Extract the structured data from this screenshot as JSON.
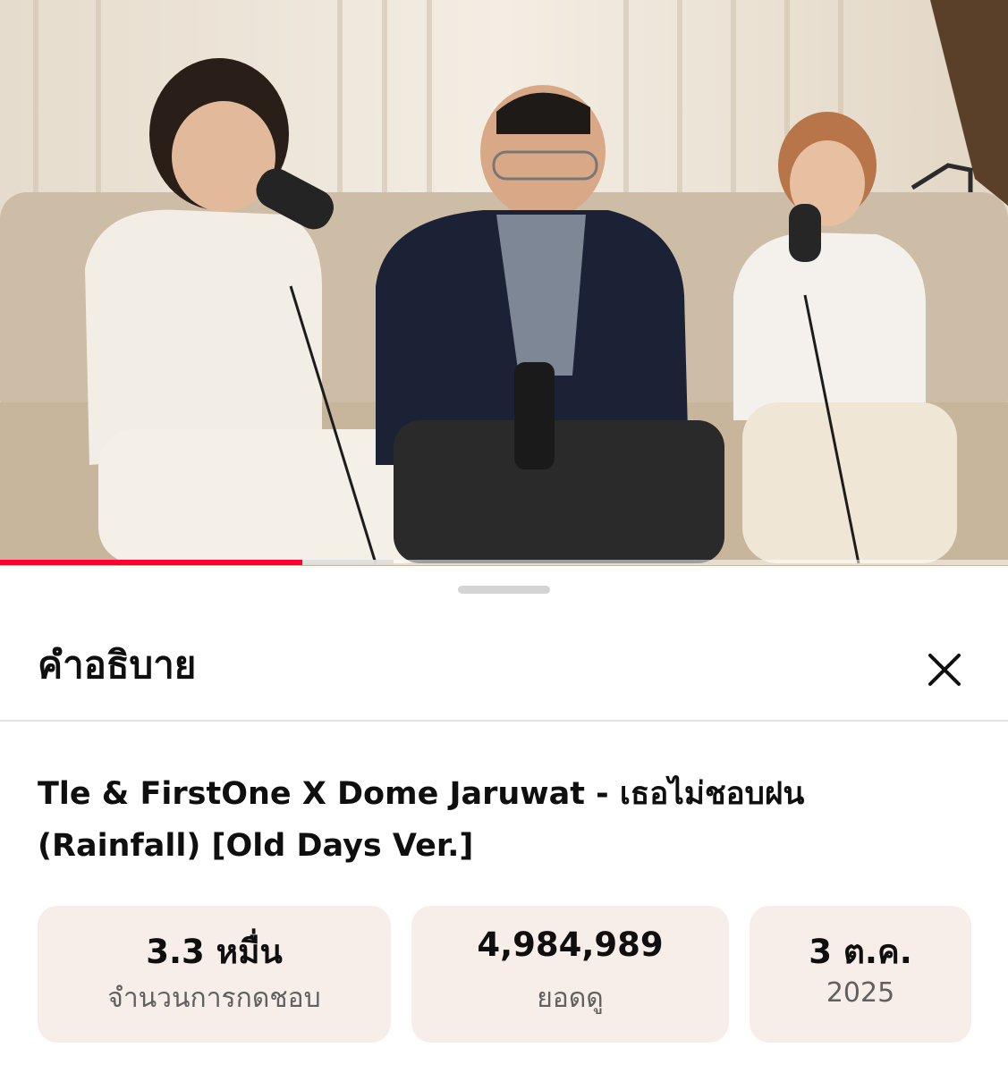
{
  "video": {
    "scene_description_icon": "video-frame-three-singers-on-sofa",
    "progress_fraction": 0.3,
    "buffered_fraction": 0.39
  },
  "sheet": {
    "title": "คำอธิบาย",
    "close_icon": "close-icon"
  },
  "details": {
    "title": "Tle & FirstOne X Dome Jaruwat - เธอไม่ชอบฝน (Rainfall) [Old Days Ver.]"
  },
  "stats": {
    "likes_value": "3.3 หมื่น",
    "likes_label": "จำนวนการกดชอบ",
    "views_value": "4,984,989",
    "views_label": "ยอดดู",
    "date_value": "3 ต.ค.",
    "date_year": "2025"
  },
  "colors": {
    "progress": "#ff0033",
    "stat_background": "#f7eeea"
  }
}
